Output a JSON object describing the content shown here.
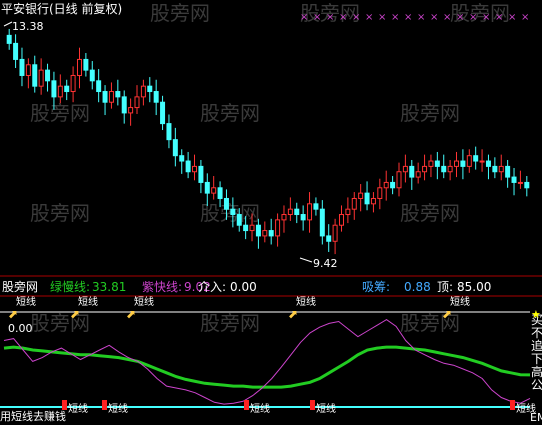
{
  "header": {
    "title": "平安银行(日线 前复权)"
  },
  "watermark": "股旁网",
  "price_panel": {
    "high_label": "13.38",
    "low_label": "9.42"
  },
  "indicator_panel": {
    "brand": "股旁网",
    "items": [
      {
        "label": "绿慢线:",
        "value": "33.81",
        "color": "#22cc22"
      },
      {
        "label": "紫快线:",
        "value": "9.02",
        "color": "#cc44cc"
      },
      {
        "label": "介入:",
        "value": "0.00",
        "color": "#ffffff"
      },
      {
        "label": "吸筹:",
        "value": "0.88",
        "color": "#44aaff"
      },
      {
        "label": "顶:",
        "value": "85.00",
        "color": "#ffffff"
      }
    ],
    "right_labels": [
      "买",
      "不",
      "追",
      "下",
      "高",
      "公"
    ],
    "buy_label": "短线",
    "sell_label": "短线",
    "bottom_left": "用短线去赚钱",
    "left_value": "0.00",
    "right_tag": "EM"
  },
  "chart_data": [
    {
      "type": "candlestick",
      "title": "平安银行(日线 前复权)",
      "annotations": [
        {
          "text": "13.38",
          "kind": "high"
        },
        {
          "text": "9.42",
          "kind": "low"
        }
      ],
      "ylim": [
        9.0,
        13.6
      ],
      "close": [
        13.2,
        12.9,
        12.6,
        12.8,
        12.4,
        12.7,
        12.5,
        12.2,
        12.4,
        12.3,
        12.6,
        12.9,
        12.7,
        12.5,
        12.3,
        12.1,
        12.3,
        12.2,
        11.9,
        12.0,
        12.2,
        12.4,
        12.3,
        12.1,
        11.7,
        11.4,
        11.1,
        11.0,
        10.8,
        10.9,
        10.6,
        10.4,
        10.5,
        10.3,
        10.1,
        10.0,
        9.8,
        9.7,
        9.8,
        9.6,
        9.7,
        9.6,
        9.9,
        10.0,
        10.1,
        10.0,
        9.9,
        10.2,
        10.1,
        9.6,
        9.5,
        9.8,
        10.0,
        10.1,
        10.3,
        10.4,
        10.2,
        10.3,
        10.5,
        10.6,
        10.5,
        10.8,
        10.9,
        10.7,
        10.8,
        10.9,
        11.0,
        10.9,
        10.8,
        10.9,
        11.0,
        10.9,
        11.1,
        11.0,
        11.0,
        10.9,
        10.8,
        10.9,
        10.7,
        10.6,
        10.6,
        10.5
      ],
      "series_color_up": "#ff3333",
      "series_color_down": "#44ffff"
    },
    {
      "type": "line",
      "series": [
        {
          "name": "绿慢线",
          "color": "#22cc22",
          "values": [
            62,
            63,
            62,
            60,
            59,
            58,
            57,
            56,
            55,
            55,
            54,
            53,
            52,
            50,
            48,
            44,
            40,
            36,
            32,
            29,
            27,
            25,
            24,
            23,
            22,
            22,
            21,
            21,
            21,
            21,
            22,
            24,
            26,
            30,
            36,
            42,
            48,
            55,
            60,
            62,
            63,
            63,
            62,
            61,
            60,
            58,
            56,
            54,
            52,
            49,
            46,
            42,
            38,
            36,
            34,
            33.81
          ]
        },
        {
          "name": "紫快线",
          "color": "#cc44cc",
          "values": [
            70,
            72,
            60,
            48,
            52,
            58,
            62,
            56,
            50,
            55,
            60,
            65,
            58,
            52,
            48,
            40,
            30,
            22,
            20,
            18,
            15,
            10,
            5,
            3,
            4,
            6,
            12,
            20,
            30,
            42,
            55,
            68,
            78,
            84,
            88,
            90,
            82,
            74,
            80,
            86,
            92,
            85,
            70,
            60,
            55,
            50,
            46,
            44,
            40,
            36,
            30,
            18,
            10,
            6,
            4,
            9.02
          ]
        }
      ]
    }
  ]
}
